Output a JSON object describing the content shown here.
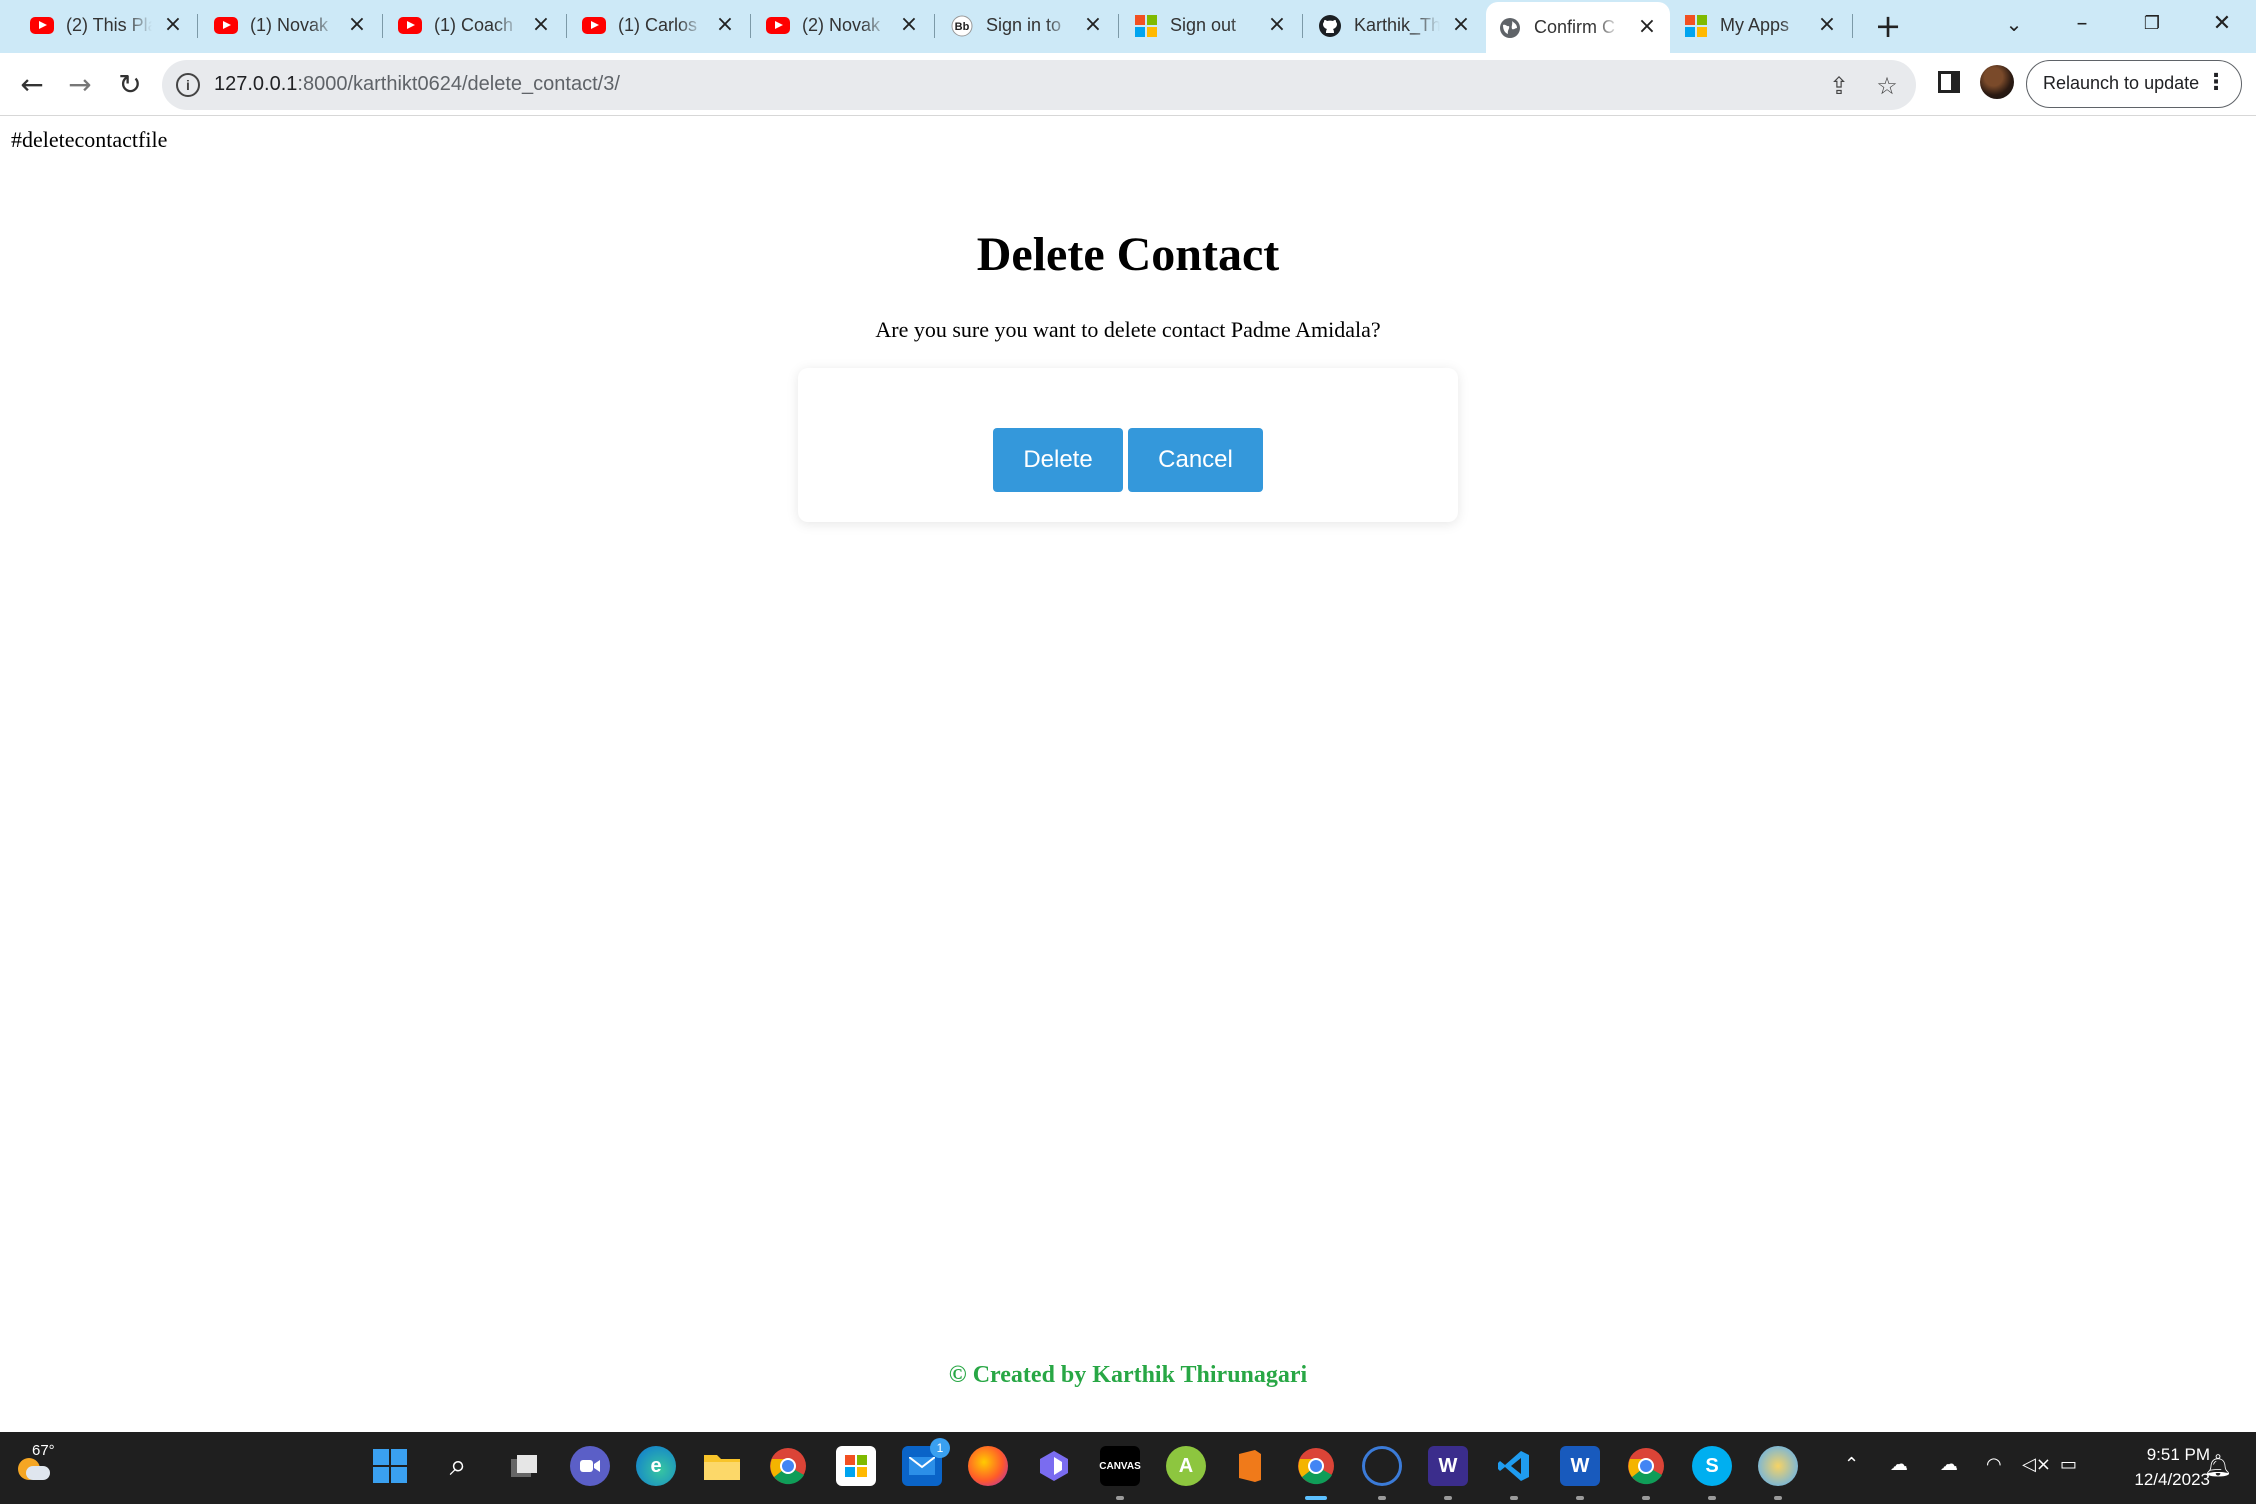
{
  "browser": {
    "tabs": [
      {
        "title": "(2) This Place",
        "favicon": "youtube-icon"
      },
      {
        "title": "(1) Novak",
        "favicon": "youtube-icon"
      },
      {
        "title": "(1) Coach",
        "favicon": "youtube-icon"
      },
      {
        "title": "(1) Carlos",
        "favicon": "youtube-icon"
      },
      {
        "title": "(2) Novak",
        "favicon": "youtube-icon"
      },
      {
        "title": "Sign in to",
        "favicon": "blackboard-icon"
      },
      {
        "title": "Sign out",
        "favicon": "microsoft-icon"
      },
      {
        "title": "Karthik_Th",
        "favicon": "github-icon"
      },
      {
        "title": "Confirm C",
        "favicon": "globe-icon",
        "active": true
      },
      {
        "title": "My Apps",
        "favicon": "microsoft-icon"
      }
    ],
    "new_tab_label": "+",
    "url_host": "127.0.0.1",
    "url_rest": ":8000/karthikt0624/delete_contact/3/",
    "relaunch_label": "Relaunch to update"
  },
  "page": {
    "file_tag": "#deletecontactfile",
    "heading": "Delete Contact",
    "prompt": "Are you sure you want to delete contact Padme Amidala?",
    "delete_label": "Delete",
    "cancel_label": "Cancel",
    "footer": "© Created by Karthik Thirunagari"
  },
  "colors": {
    "button": "#3498db",
    "footer": "#28a745",
    "tabstrip": "#cde9f7"
  },
  "taskbar": {
    "temperature": "67°",
    "mail_badge": "1",
    "time": "9:51 PM",
    "date": "12/4/2023"
  }
}
